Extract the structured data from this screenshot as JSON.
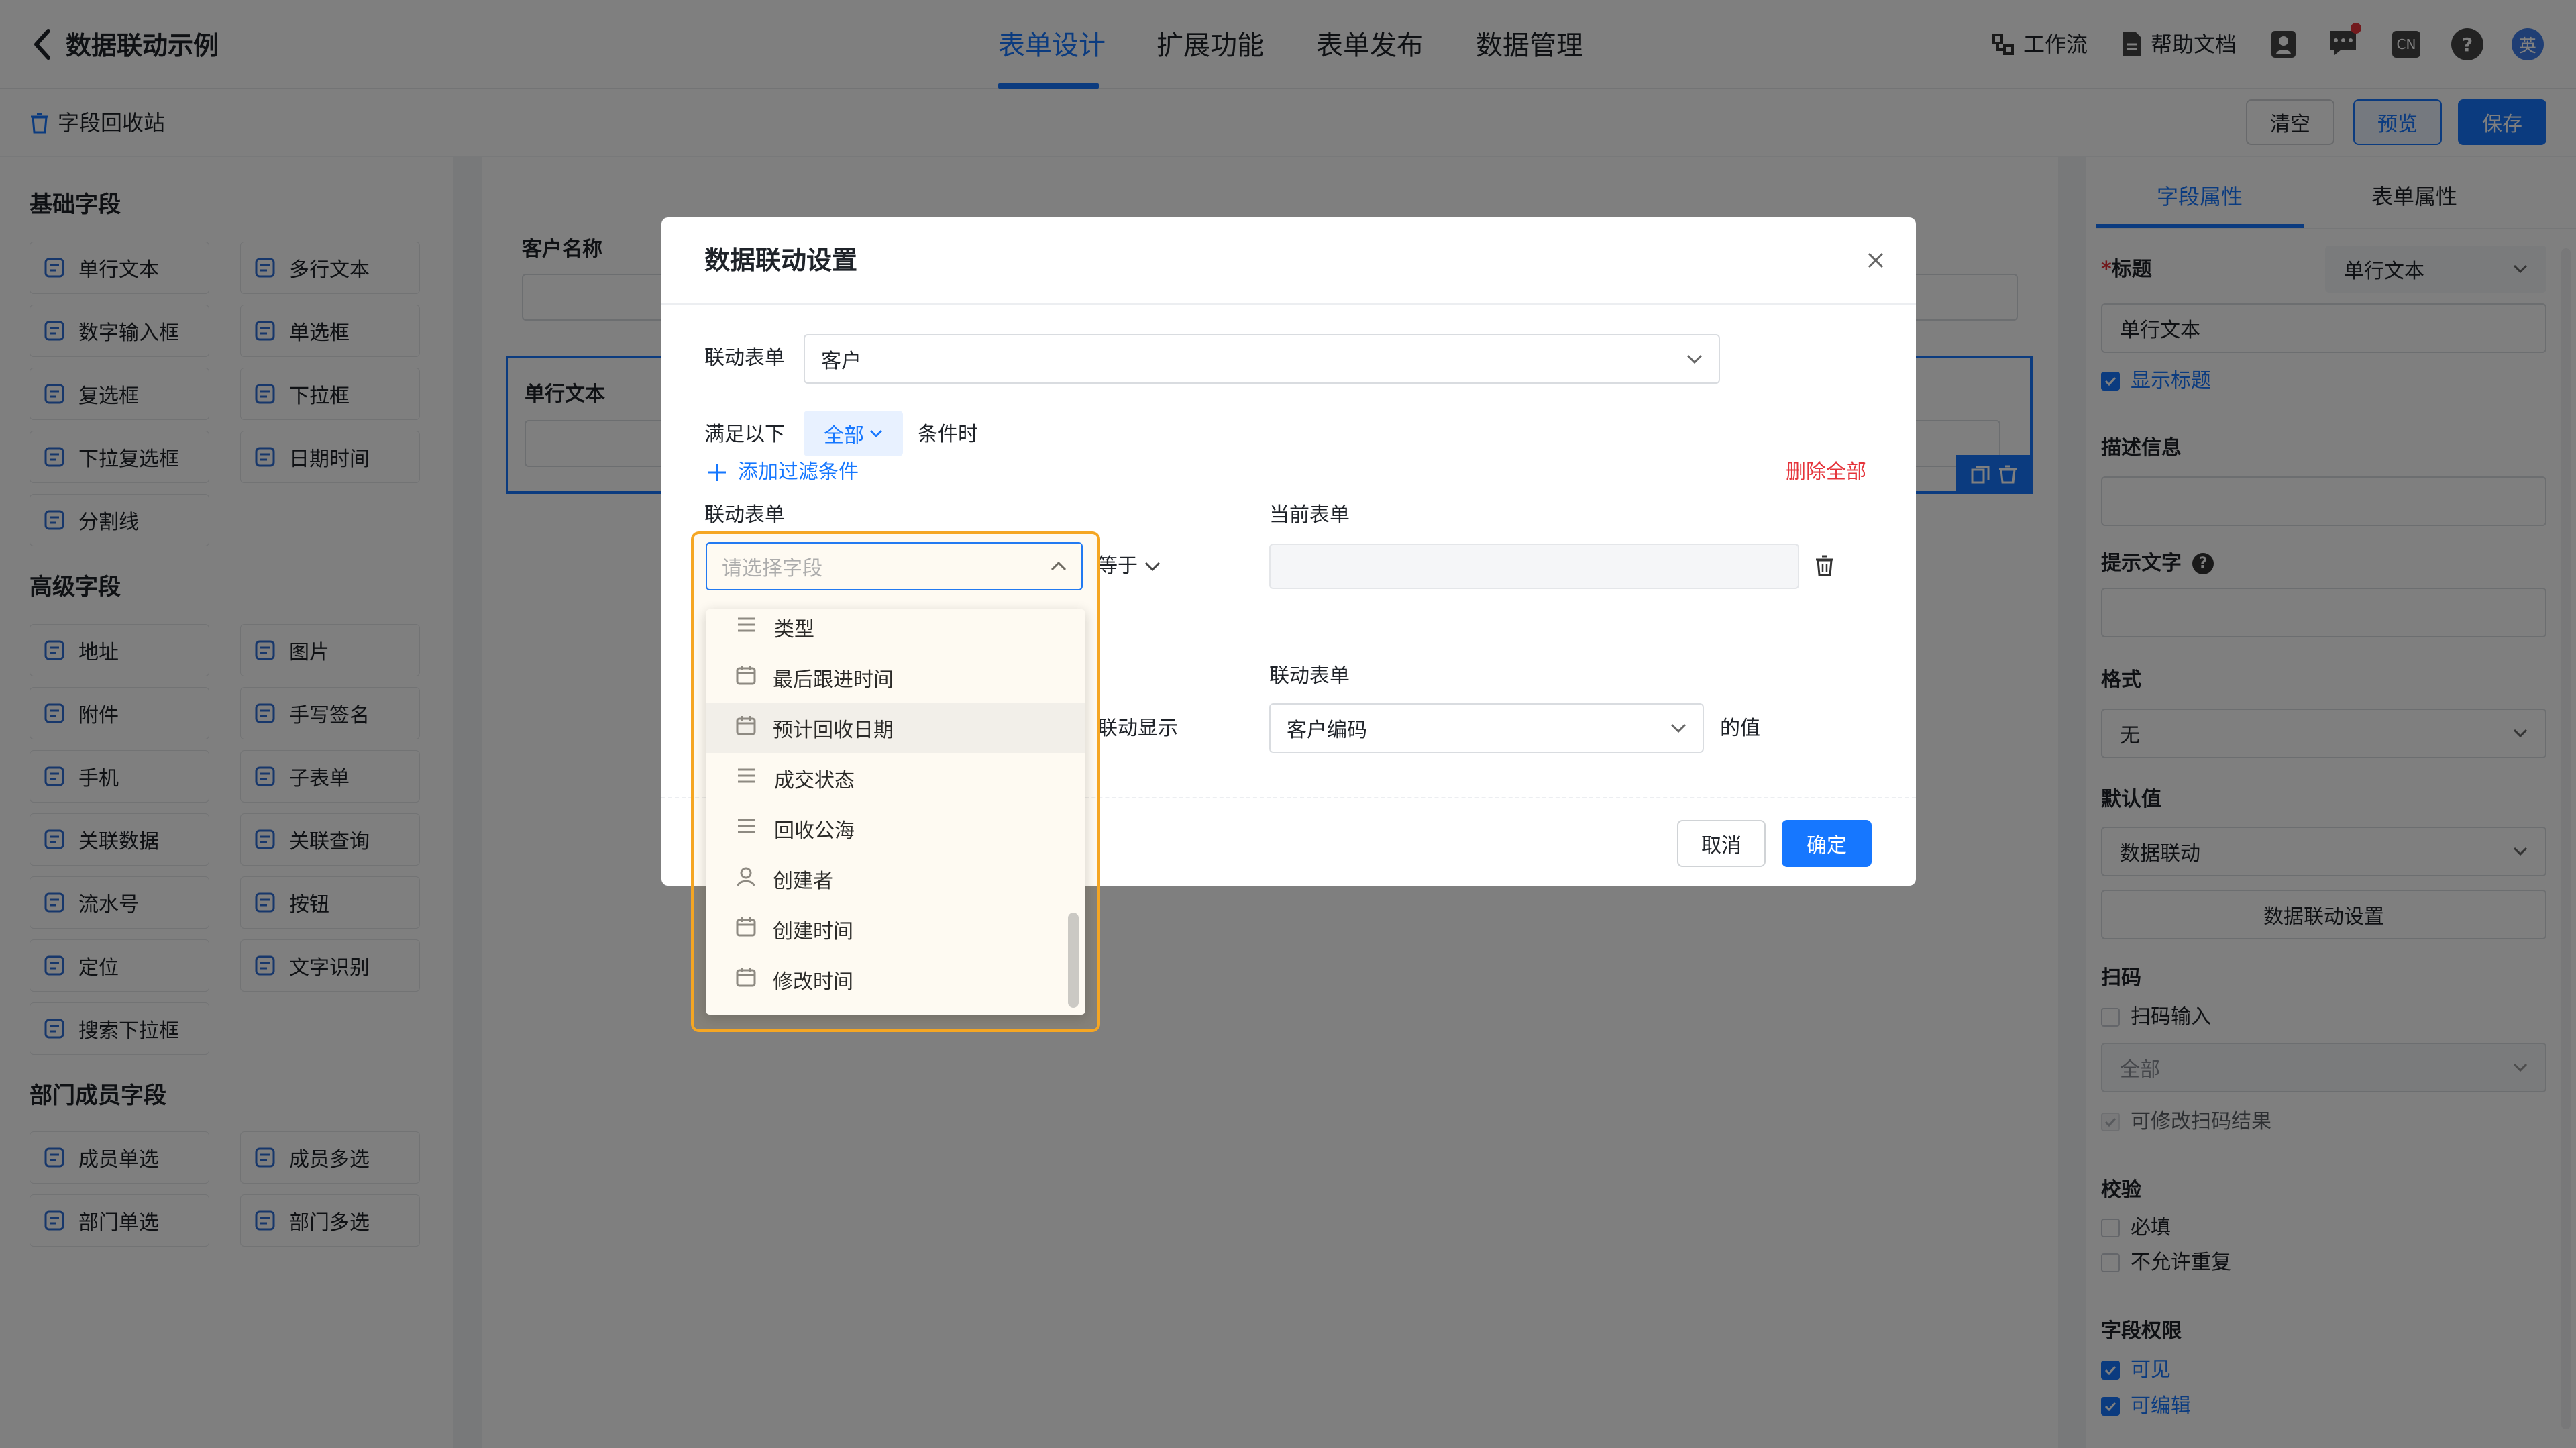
{
  "topbar": {
    "app_title": "数据联动示例",
    "tabs": [
      "表单设计",
      "扩展功能",
      "表单发布",
      "数据管理"
    ],
    "workflow": "工作流",
    "help_docs": "帮助文档",
    "user_initial": "英",
    "cn_badge": "CN"
  },
  "toolbar": {
    "recycle": "字段回收站",
    "clear": "清空",
    "preview": "预览",
    "save": "保存"
  },
  "left": {
    "groups": [
      {
        "title": "基础字段",
        "items": [
          "单行文本",
          "多行文本",
          "数字输入框",
          "单选框",
          "复选框",
          "下拉框",
          "下拉复选框",
          "日期时间",
          "分割线"
        ]
      },
      {
        "title": "高级字段",
        "items": [
          "地址",
          "图片",
          "附件",
          "手写签名",
          "手机",
          "子表单",
          "关联数据",
          "关联查询",
          "流水号",
          "按钮",
          "定位",
          "文字识别",
          "搜索下拉框"
        ]
      },
      {
        "title": "部门成员字段",
        "items": [
          "成员单选",
          "成员多选",
          "部门单选",
          "部门多选"
        ]
      }
    ]
  },
  "canvas": {
    "field1_label": "客户名称",
    "field2_label": "单行文本"
  },
  "right": {
    "tabs": [
      "字段属性",
      "表单属性"
    ],
    "title_label": "标题",
    "title_type": "单行文本",
    "title_value": "单行文本",
    "show_title": "显示标题",
    "desc_label": "描述信息",
    "hint_label": "提示文字",
    "format_label": "格式",
    "format_value": "无",
    "default_label": "默认值",
    "default_value": "数据联动",
    "linkage_button": "数据联动设置",
    "scan_label": "扫码",
    "scan_input": "扫码输入",
    "scan_select": "全部",
    "scan_modify": "可修改扫码结果",
    "validate_label": "校验",
    "required": "必填",
    "no_duplicate": "不允许重复",
    "perm_label": "字段权限",
    "visible": "可见",
    "editable": "可编辑"
  },
  "modal": {
    "title": "数据联动设置",
    "linked_form_label": "联动表单",
    "linked_form_value": "客户",
    "satisfy_prefix": "满足以下",
    "condition_all": "全部",
    "satisfy_suffix": "条件时",
    "add_filter": "添加过滤条件",
    "delete_all": "删除全部",
    "col_linked": "联动表单",
    "col_current": "当前表单",
    "field_placeholder": "请选择字段",
    "operator": "等于",
    "linked_display": "联动显示",
    "display_col": "联动表单",
    "display_value": "客户编码",
    "value_suffix": "的值",
    "cancel": "取消",
    "ok": "确定",
    "dropdown": [
      {
        "label": "类型",
        "icon": "list-icon"
      },
      {
        "label": "最后跟进时间",
        "icon": "calendar-icon"
      },
      {
        "label": "预计回收日期",
        "icon": "calendar-icon"
      },
      {
        "label": "成交状态",
        "icon": "list-icon"
      },
      {
        "label": "回收公海",
        "icon": "list-icon"
      },
      {
        "label": "创建者",
        "icon": "user-icon"
      },
      {
        "label": "创建时间",
        "icon": "calendar-icon"
      },
      {
        "label": "修改时间",
        "icon": "calendar-icon"
      }
    ]
  },
  "colors": {
    "accent": "#1677ff",
    "danger": "#e5343b",
    "highlight": "#f5a623"
  }
}
